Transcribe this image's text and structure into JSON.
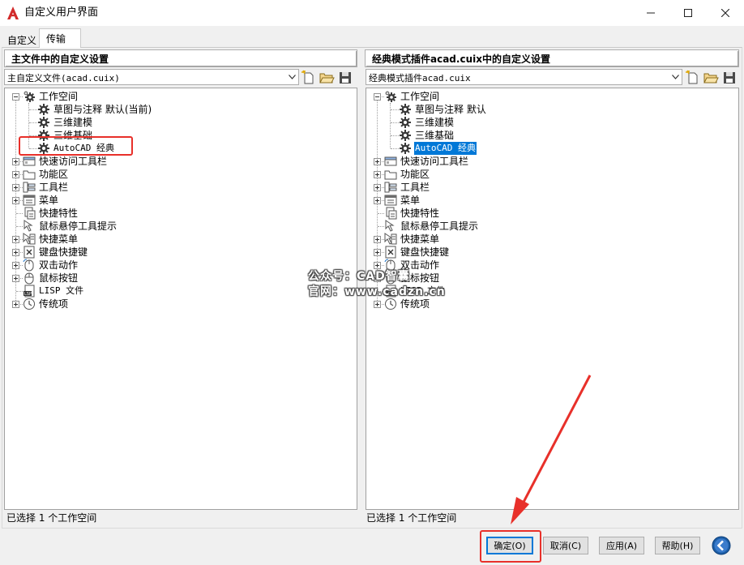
{
  "window": {
    "title": "自定义用户界面",
    "app_logo_letter": "A",
    "controls": {
      "minimize": "─",
      "maximize": "☐",
      "close": "✕"
    }
  },
  "tabs": [
    {
      "label": "自定义",
      "active": false
    },
    {
      "label": "传输",
      "active": true
    }
  ],
  "left_panel": {
    "header": "主文件中的自定义设置",
    "file_combo": "主自定义文件(acad.cuix)",
    "status": "已选择 1 个工作空间",
    "workspaces": {
      "label": "工作空间",
      "children": [
        {
          "label": "草图与注释 默认(当前)"
        },
        {
          "label": "三维建模"
        },
        {
          "label": "三维基础"
        },
        {
          "label": "AutoCAD 经典"
        }
      ]
    },
    "nodes": [
      {
        "label": "快速访问工具栏"
      },
      {
        "label": "功能区"
      },
      {
        "label": "工具栏"
      },
      {
        "label": "菜单"
      },
      {
        "label": "快捷特性"
      },
      {
        "label": "鼠标悬停工具提示"
      },
      {
        "label": "快捷菜单"
      },
      {
        "label": "键盘快捷键"
      },
      {
        "label": "双击动作"
      },
      {
        "label": "鼠标按钮"
      },
      {
        "label": "LISP 文件"
      },
      {
        "label": "传统项"
      }
    ]
  },
  "right_panel": {
    "header": "经典模式插件acad.cuix中的自定义设置",
    "file_combo": "经典模式插件acad.cuix",
    "status": "已选择 1 个工作空间",
    "workspaces": {
      "label": "工作空间",
      "children": [
        {
          "label": "草图与注释 默认"
        },
        {
          "label": "三维建模"
        },
        {
          "label": "三维基础"
        },
        {
          "label": "AutoCAD 经典",
          "selected": true
        }
      ]
    },
    "nodes": [
      {
        "label": "快速访问工具栏"
      },
      {
        "label": "功能区"
      },
      {
        "label": "工具栏"
      },
      {
        "label": "菜单"
      },
      {
        "label": "快捷特性"
      },
      {
        "label": "鼠标悬停工具提示"
      },
      {
        "label": "快捷菜单"
      },
      {
        "label": "键盘快捷键"
      },
      {
        "label": "双击动作"
      },
      {
        "label": "鼠标按钮"
      },
      {
        "label": "LISP 文件"
      },
      {
        "label": "传统项"
      }
    ]
  },
  "buttons": {
    "ok": "确定(O)",
    "cancel": "取消(C)",
    "apply": "应用(A)",
    "help": "帮助(H)"
  },
  "watermark": {
    "line1": "公众号：CAD智囊",
    "line2": "官网：www.cadzn.cn"
  },
  "colors": {
    "selection": "#0078d7",
    "highlight": "#e8302a",
    "logo": "#d22b2b"
  }
}
